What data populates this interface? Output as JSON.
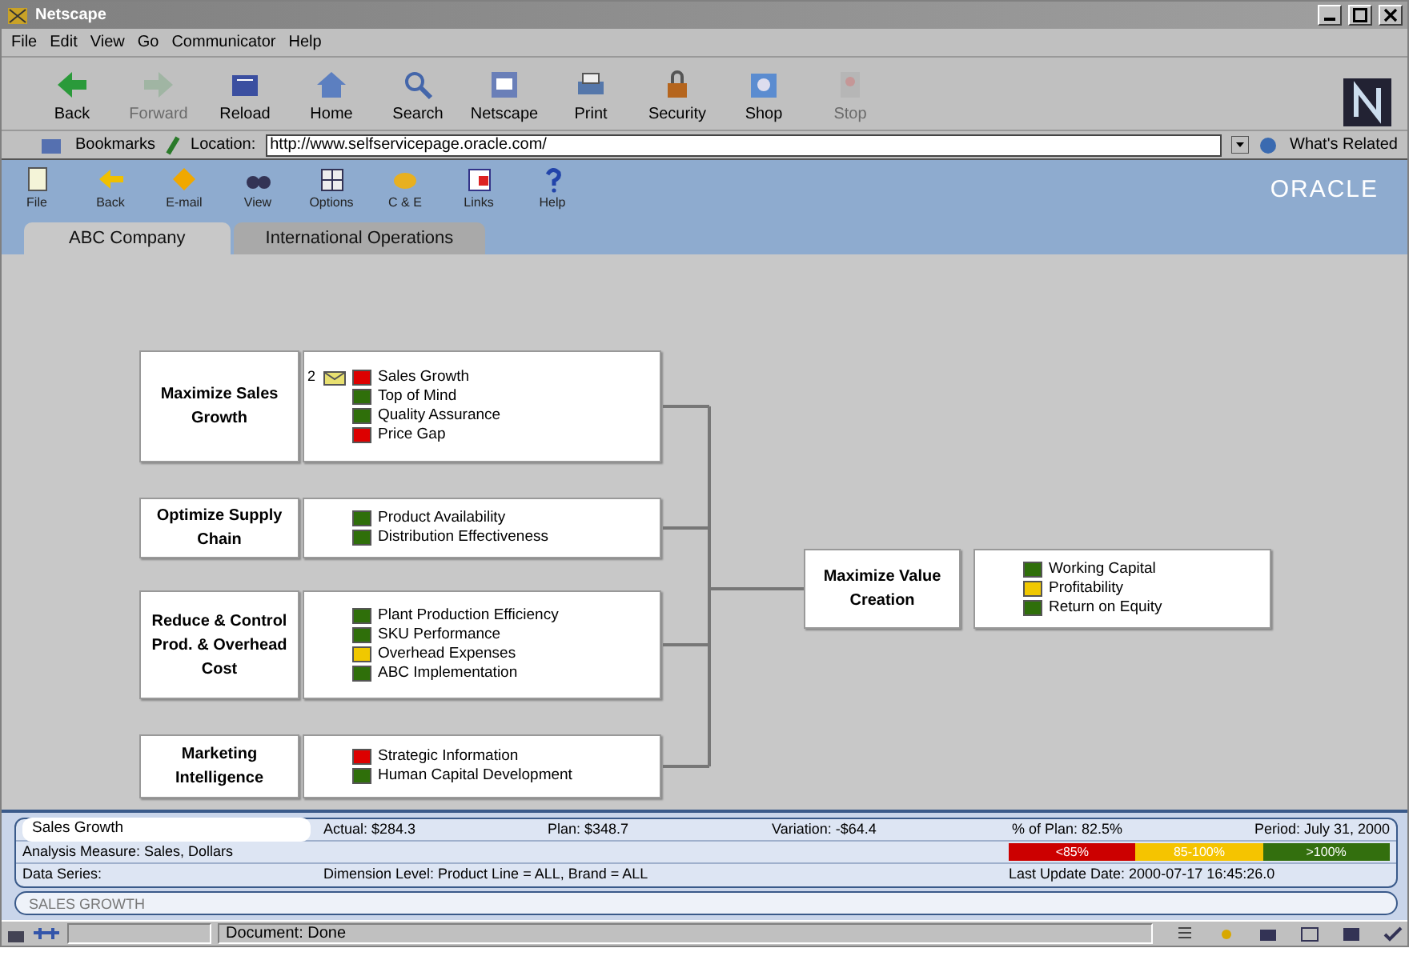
{
  "window": {
    "title": "Netscape"
  },
  "menu": [
    "File",
    "Edit",
    "View",
    "Go",
    "Communicator",
    "Help"
  ],
  "nav_toolbar": [
    {
      "label": "Back",
      "disabled": false
    },
    {
      "label": "Forward",
      "disabled": true
    },
    {
      "label": "Reload",
      "disabled": false
    },
    {
      "label": "Home",
      "disabled": false
    },
    {
      "label": "Search",
      "disabled": false
    },
    {
      "label": "Netscape",
      "disabled": false
    },
    {
      "label": "Print",
      "disabled": false
    },
    {
      "label": "Security",
      "disabled": false
    },
    {
      "label": "Shop",
      "disabled": false
    },
    {
      "label": "Stop",
      "disabled": true
    }
  ],
  "location_bar": {
    "bookmarks": "Bookmarks",
    "location_label": "Location:",
    "url": "http://www.selfservicepage.oracle.com/",
    "related": "What's Related"
  },
  "app_toolbar": [
    "File",
    "Back",
    "E-mail",
    "View",
    "Options",
    "C & E",
    "Links",
    "Help"
  ],
  "brand": "ORACLE",
  "tabs": [
    {
      "label": "ABC Company",
      "selected": true
    },
    {
      "label": "International Operations",
      "selected": false
    }
  ],
  "objectives": [
    {
      "title": "Maximize Sales Growth",
      "measures": [
        {
          "label": "Sales Growth",
          "color": "#dd0000",
          "note_count": "2",
          "has_mail": true
        },
        {
          "label": "Top of Mind",
          "color": "#2f6f0a"
        },
        {
          "label": "Quality Assurance",
          "color": "#2f6f0a"
        },
        {
          "label": "Price Gap",
          "color": "#dd0000"
        }
      ]
    },
    {
      "title": "Optimize Supply Chain",
      "measures": [
        {
          "label": "Product Availability",
          "color": "#2f6f0a"
        },
        {
          "label": "Distribution Effectiveness",
          "color": "#2f6f0a"
        }
      ]
    },
    {
      "title": "Reduce & Control Prod. & Overhead Cost",
      "measures": [
        {
          "label": "Plant Production Efficiency",
          "color": "#2f6f0a"
        },
        {
          "label": "SKU Performance",
          "color": "#2f6f0a"
        },
        {
          "label": "Overhead Expenses",
          "color": "#f0c800"
        },
        {
          "label": "ABC Implementation",
          "color": "#2f6f0a"
        }
      ]
    },
    {
      "title": "Marketing Intelligence",
      "measures": [
        {
          "label": "Strategic Information",
          "color": "#dd0000"
        },
        {
          "label": "Human Capital Development",
          "color": "#2f6f0a"
        }
      ]
    }
  ],
  "result": {
    "title": "Maximize Value Creation",
    "measures": [
      {
        "label": "Working Capital",
        "color": "#2f6f0a"
      },
      {
        "label": "Profitability",
        "color": "#f0c800"
      },
      {
        "label": "Return on Equity",
        "color": "#2f6f0a"
      }
    ]
  },
  "detail": {
    "measure": "Sales Growth",
    "actual": "Actual: $284.3",
    "plan": "Plan: $348.7",
    "variation": "Variation: -$64.4",
    "percent": "% of Plan: 82.5%",
    "period": "Period: July 31, 2000",
    "analysis": "Analysis Measure: Sales, Dollars",
    "legend": [
      {
        "label": "<85%",
        "color": "#cc0000"
      },
      {
        "label": "85-100%",
        "color": "#f5c400"
      },
      {
        "label": ">100%",
        "color": "#336f0e"
      }
    ],
    "data_series": "Data Series:",
    "dimension": "Dimension Level: Product Line = ALL, Brand = ALL",
    "updated": "Last Update Date: 2000-07-17 16:45:26.0",
    "footer": "SALES GROWTH"
  },
  "status_bar": {
    "text": "Document: Done"
  }
}
